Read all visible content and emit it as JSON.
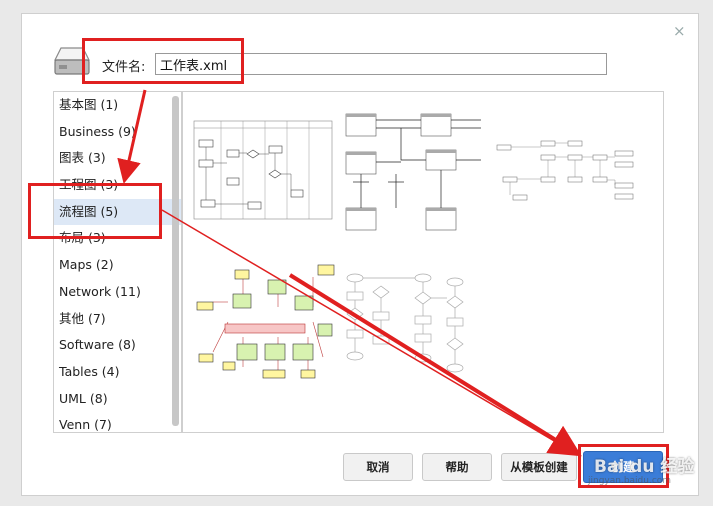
{
  "dialog": {
    "close_glyph": "×",
    "filename_label": "文件名:",
    "filename_value": "工作表.xml"
  },
  "categories": [
    {
      "label": "基本图 (1)"
    },
    {
      "label": "Business (9)"
    },
    {
      "label": "图表 (3)"
    },
    {
      "label": "工程图 (3)"
    },
    {
      "label": "流程图 (5)"
    },
    {
      "label": "布局 (3)"
    },
    {
      "label": "Maps (2)"
    },
    {
      "label": "Network (11)"
    },
    {
      "label": "其他 (7)"
    },
    {
      "label": "Software (8)"
    },
    {
      "label": "Tables (4)"
    },
    {
      "label": "UML (8)"
    },
    {
      "label": "Venn (7)"
    }
  ],
  "selected_category": "流程图 (5)",
  "buttons": {
    "cancel": "取消",
    "help": "帮助",
    "from_template": "从模板创建",
    "create": "创建"
  },
  "watermark": {
    "text": "Bai du 经验",
    "url": "jingyan.baidu.com"
  },
  "colors": {
    "accent": "#3b7dd8",
    "highlight": "#e02020",
    "selected_row": "#dde8f6"
  }
}
